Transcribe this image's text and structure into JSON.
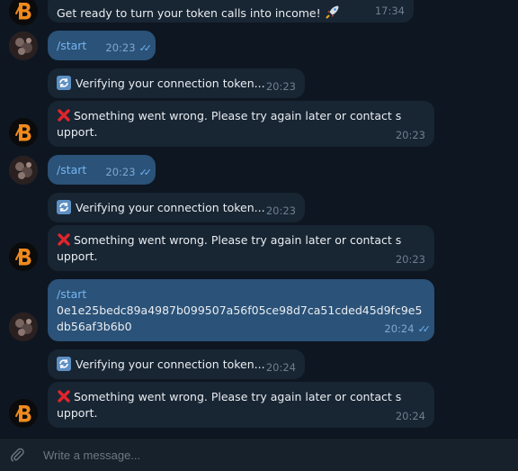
{
  "chat": {
    "messages": [
      {
        "kind": "in",
        "avatar": "bot",
        "text": "Get ready to turn your token calls into income!",
        "emoji": "rocket",
        "time": "17:34"
      },
      {
        "kind": "out",
        "avatar": "user",
        "command": "/start",
        "time": "20:23",
        "read": true
      },
      {
        "kind": "in",
        "emoji": "sync",
        "text": "Verifying your connection token...",
        "time": "20:23"
      },
      {
        "kind": "in",
        "avatar": "bot",
        "emoji": "cross",
        "text": "Something went wrong. Please try again later or contact support.",
        "time": "20:23"
      },
      {
        "kind": "out",
        "avatar": "user",
        "command": "/start",
        "time": "20:23",
        "read": true
      },
      {
        "kind": "in",
        "emoji": "sync",
        "text": "Verifying your connection token...",
        "time": "20:23"
      },
      {
        "kind": "in",
        "avatar": "bot",
        "emoji": "cross",
        "text": "Something went wrong. Please try again later or contact support.",
        "time": "20:23"
      },
      {
        "kind": "out",
        "avatar": "user",
        "command": "/start",
        "text": "0e1e25bedc89a4987b099507a56f05ce98d7ca51cded45d9fc9e5db56af3b6b0",
        "time": "20:24",
        "read": true
      },
      {
        "kind": "in",
        "emoji": "sync",
        "text": "Verifying your connection token...",
        "time": "20:24"
      },
      {
        "kind": "in",
        "avatar": "bot",
        "emoji": "cross",
        "text": "Something went wrong. Please try again later or contact support.",
        "time": "20:24"
      }
    ]
  },
  "composer": {
    "placeholder": "Write a message..."
  },
  "colors": {
    "background": "#0e1621",
    "incoming_bubble": "#182533",
    "outgoing_bubble": "#2b5278",
    "command_link": "#75b6f2",
    "read_ticks": "#6fb4f0",
    "bot_logo": "#f08a1c"
  }
}
